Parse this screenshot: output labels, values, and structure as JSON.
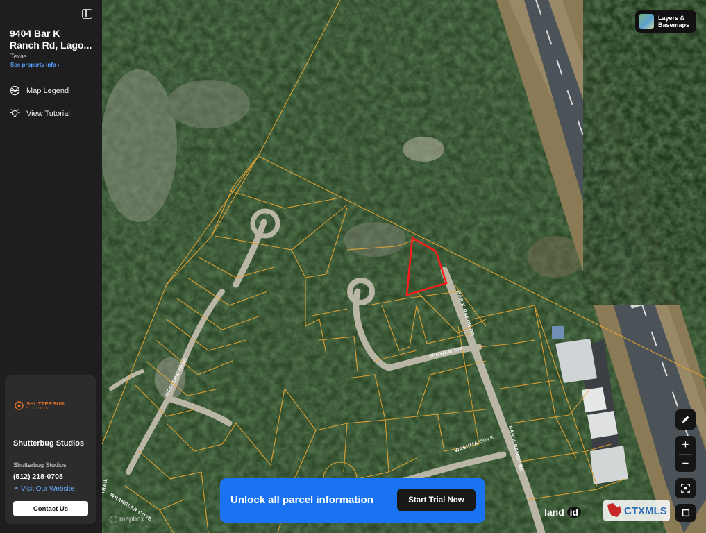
{
  "sidebar": {
    "address_line1": "9404 Bar K",
    "address_line2": "Ranch Rd, Lago...",
    "state": "Texas",
    "see_property_info": "See property info",
    "nav": [
      {
        "label": "Map Legend",
        "icon": "globe-icon"
      },
      {
        "label": "View Tutorial",
        "icon": "lightbulb-icon"
      }
    ]
  },
  "promo": {
    "logo_text": "SHUTTERBUG",
    "logo_sub": "STUDIOS",
    "name": "Shutterbug Studios",
    "company": "Shutterbug Studios",
    "phone": "(512) 218-0708",
    "website": "Visit Our Website",
    "contact_button": "Contact Us",
    "accent_color": "#e4702a"
  },
  "map": {
    "layers_button": "Layers & Basemaps",
    "unlock_text": "Unlock all parcel information",
    "trial_button": "Start Trial Now",
    "zoom_in": "+",
    "zoom_out": "−",
    "brand_land": "land",
    "brand_id": "id",
    "mapbox_attribution": "mapbox",
    "mls_logo": "CTXMLS",
    "parcel_color": "#e5a334",
    "selected_parcel_color": "#ff1a1a",
    "street_labels": [
      "BAR K RANCH RD",
      "WIGWAM CIR",
      "WASHITA COVE",
      "BAR K RANCH RD",
      "WESTERN TRAIL",
      "WRANGLER COVE",
      "TRAIL"
    ]
  }
}
